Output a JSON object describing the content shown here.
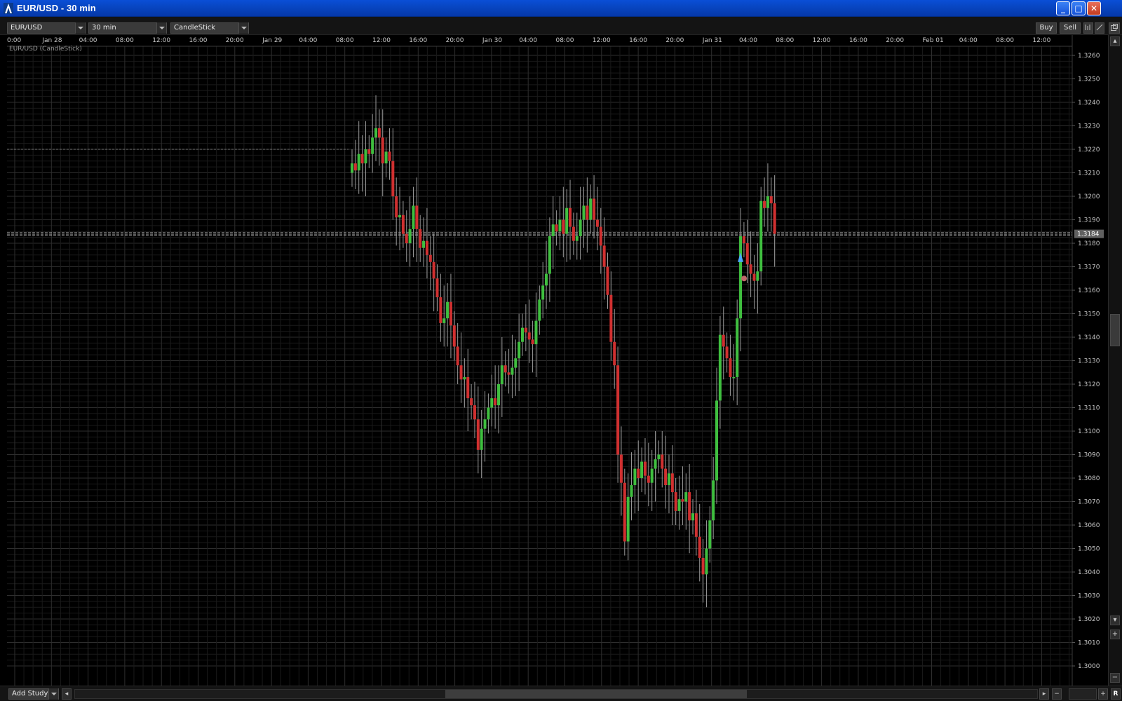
{
  "window": {
    "title": "EUR/USD - 30 min",
    "buttons": {
      "minimize": "_",
      "maximize": "□",
      "close": "✕"
    }
  },
  "toolbar": {
    "symbol": "EUR/USD",
    "interval": "30 min",
    "chart_type": "CandleStick",
    "buy_label": "Buy",
    "sell_label": "Sell"
  },
  "chart": {
    "label": "EUR/USD (CandleStick)",
    "current_price_label": "1.3184",
    "colors": {
      "up": "#3fbf3f",
      "down": "#d03030",
      "grid": "#262626",
      "background": "#000000"
    }
  },
  "bottom": {
    "add_study_label": "Add Study",
    "zoom_label": "R"
  },
  "chart_data": {
    "type": "candlestick",
    "title": "EUR/USD (CandleStick)",
    "interval": "30 min",
    "x_tick_labels": [
      "0:00",
      "Jan 28",
      "04:00",
      "08:00",
      "12:00",
      "16:00",
      "20:00",
      "Jan 29",
      "04:00",
      "08:00",
      "12:00",
      "16:00",
      "20:00",
      "Jan 30",
      "04:00",
      "08:00",
      "12:00",
      "16:00",
      "20:00",
      "Jan 31",
      "04:00",
      "08:00",
      "12:00",
      "16:00",
      "20:00",
      "Feb 01",
      "04:00",
      "08:00",
      "12:00"
    ],
    "y_tick_labels": [
      "1.3260",
      "1.3250",
      "1.3240",
      "1.3230",
      "1.3220",
      "1.3210",
      "1.3200",
      "1.3190",
      "1.3180",
      "1.3170",
      "1.3160",
      "1.3150",
      "1.3140",
      "1.3130",
      "1.3120",
      "1.3110",
      "1.3100",
      "1.3090",
      "1.3080",
      "1.3070",
      "1.3060",
      "1.3050",
      "1.3040",
      "1.3030",
      "1.3020",
      "1.3010",
      "1.3000"
    ],
    "ylim": [
      1.3,
      1.3264
    ],
    "current_price": 1.3184,
    "reference_price": 1.322,
    "closes": [
      1.3214,
      1.3211,
      1.3218,
      1.3214,
      1.322,
      1.3218,
      1.3225,
      1.3229,
      1.3225,
      1.3214,
      1.3219,
      1.3215,
      1.32,
      1.3191,
      1.3192,
      1.3184,
      1.318,
      1.3186,
      1.3196,
      1.3186,
      1.3178,
      1.3181,
      1.3175,
      1.3172,
      1.3165,
      1.3157,
      1.3146,
      1.3148,
      1.3155,
      1.3145,
      1.3136,
      1.3128,
      1.3122,
      1.3123,
      1.3114,
      1.3111,
      1.3105,
      1.3092,
      1.3101,
      1.3105,
      1.311,
      1.3114,
      1.3111,
      1.312,
      1.3128,
      1.3125,
      1.3124,
      1.3127,
      1.3131,
      1.3138,
      1.3144,
      1.3142,
      1.3139,
      1.3137,
      1.3147,
      1.3156,
      1.3162,
      1.3167,
      1.3183,
      1.3188,
      1.3185,
      1.319,
      1.3184,
      1.3195,
      1.3187,
      1.3181,
      1.3183,
      1.319,
      1.3196,
      1.319,
      1.3199,
      1.319,
      1.3187,
      1.3179,
      1.317,
      1.3158,
      1.3138,
      1.3128,
      1.309,
      1.3078,
      1.3053,
      1.3072,
      1.3077,
      1.3084,
      1.308,
      1.3087,
      1.3081,
      1.3078,
      1.3084,
      1.3088,
      1.309,
      1.3084,
      1.3077,
      1.3082,
      1.3074,
      1.3066,
      1.3071,
      1.307,
      1.3074,
      1.3062,
      1.3065,
      1.3055,
      1.3046,
      1.3039,
      1.305,
      1.3062,
      1.3079,
      1.3113,
      1.3141,
      1.3136,
      1.3131,
      1.3123,
      1.3123,
      1.3148,
      1.3183,
      1.318,
      1.3171,
      1.3167,
      1.3164,
      1.3168,
      1.3198,
      1.3195,
      1.32,
      1.3197,
      1.3184
    ]
  }
}
